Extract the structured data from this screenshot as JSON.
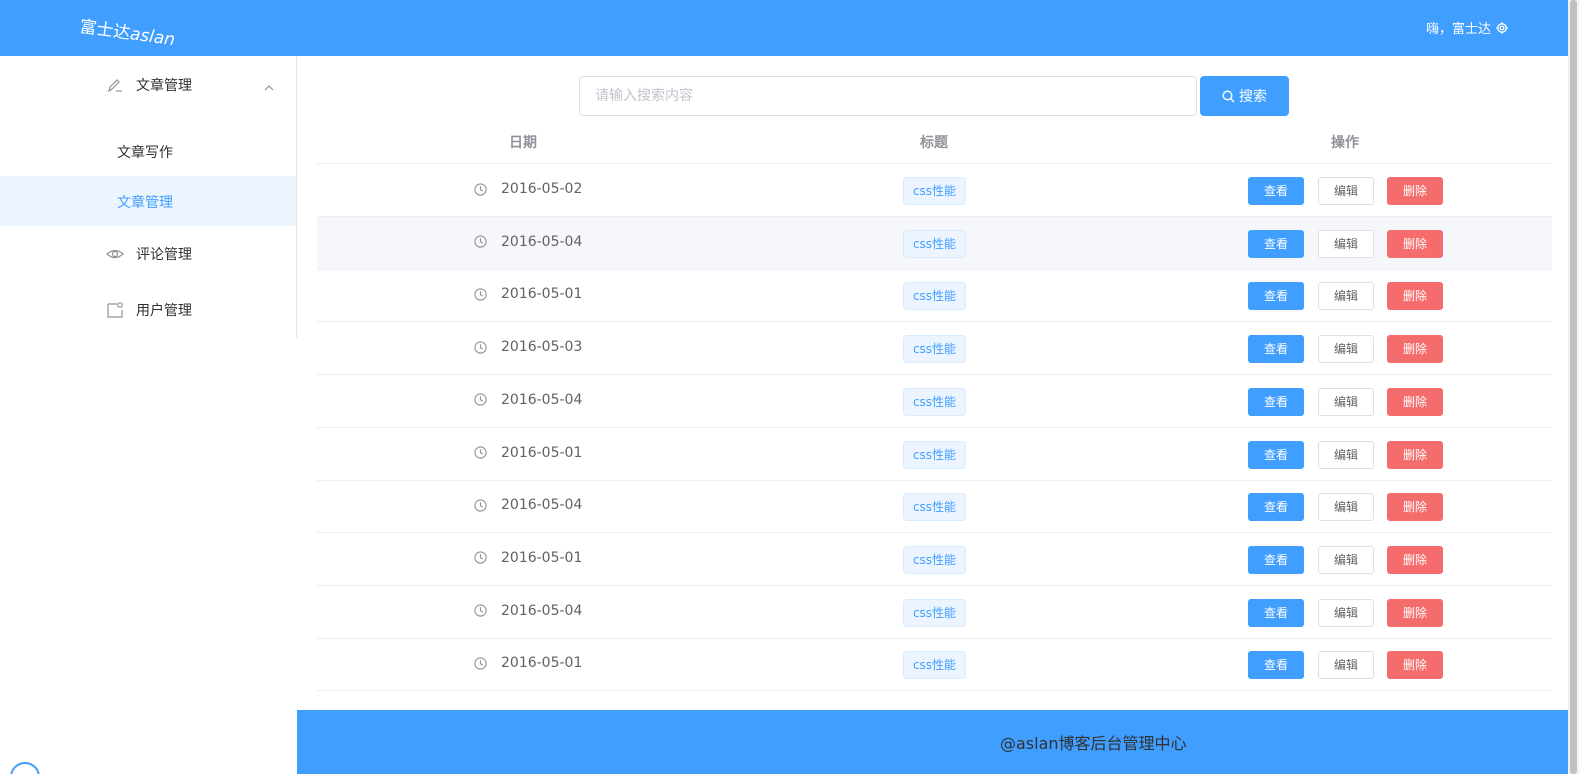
{
  "header": {
    "logo_cn": "富士达",
    "logo_en": "aslan",
    "greeting": "嗨，富士达"
  },
  "sidebar": {
    "groups": [
      {
        "label": "文章管理",
        "icon": "edit-pen-icon",
        "expanded": true,
        "children": [
          {
            "label": "文章写作",
            "active": false
          },
          {
            "label": "文章管理",
            "active": true
          }
        ]
      },
      {
        "label": "评论管理",
        "icon": "eye-icon"
      },
      {
        "label": "用户管理",
        "icon": "user-document-icon"
      }
    ]
  },
  "search": {
    "placeholder": "请输入搜索内容",
    "value": "",
    "button_label": "搜索"
  },
  "table": {
    "columns": [
      "日期",
      "标题",
      "操作"
    ],
    "rows": [
      {
        "date": "2016-05-02",
        "title": "css性能"
      },
      {
        "date": "2016-05-04",
        "title": "css性能"
      },
      {
        "date": "2016-05-01",
        "title": "css性能"
      },
      {
        "date": "2016-05-03",
        "title": "css性能"
      },
      {
        "date": "2016-05-04",
        "title": "css性能"
      },
      {
        "date": "2016-05-01",
        "title": "css性能"
      },
      {
        "date": "2016-05-04",
        "title": "css性能"
      },
      {
        "date": "2016-05-01",
        "title": "css性能"
      },
      {
        "date": "2016-05-04",
        "title": "css性能"
      },
      {
        "date": "2016-05-01",
        "title": "css性能"
      }
    ],
    "actions": {
      "view": "查看",
      "edit": "编辑",
      "delete": "删除"
    }
  },
  "footer": {
    "text": "@aslan博客后台管理中心"
  },
  "colors": {
    "primary": "#409eff",
    "danger": "#f56c6c",
    "active_bg": "#ecf5ff"
  }
}
